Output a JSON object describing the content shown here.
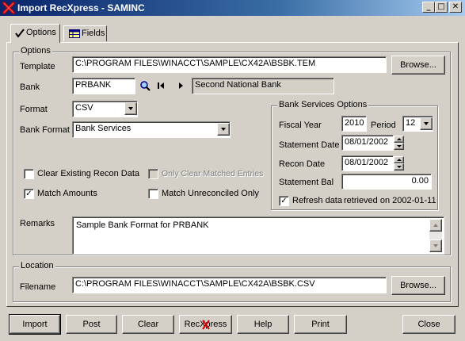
{
  "window": {
    "title": "Import RecXpress - SAMINC",
    "minimize": "_",
    "maximize": "□",
    "close": "✕"
  },
  "tabs": [
    {
      "label": "Options",
      "active": true
    },
    {
      "label": "Fields",
      "active": false
    }
  ],
  "options": {
    "group_label": "Options",
    "template_label": "Template",
    "template_value": "C:\\PROGRAM FILES\\WINACCT\\SAMPLE\\CX42A\\BSBK.TEM",
    "browse_label": "Browse...",
    "bank_label": "Bank",
    "bank_value": "PRBANK",
    "bank_name": "Second National Bank",
    "format_label": "Format",
    "format_value": "CSV",
    "bank_format_label": "Bank Format",
    "bank_format_value": "Bank Services",
    "clear_existing_label": "Clear Existing Recon Data",
    "clear_existing_checked": false,
    "only_clear_matched_label": "Only Clear Matched Entries",
    "only_clear_matched_checked": false,
    "match_amounts_label": "Match Amounts",
    "match_amounts_checked": true,
    "match_unreconciled_label": "Match Unreconciled Only",
    "match_unreconciled_checked": false,
    "remarks_label": "Remarks",
    "remarks_value": "Sample Bank Format for PRBANK"
  },
  "bank_services": {
    "group_label": "Bank Services Options",
    "fiscal_year_label": "Fiscal Year",
    "fiscal_year_value": "2010",
    "period_label": "Period",
    "period_value": "12",
    "statement_date_label": "Statement Date",
    "statement_date_value": "08/01/2002",
    "recon_date_label": "Recon Date",
    "recon_date_value": "08/01/2002",
    "statement_bal_label": "Statement Bal",
    "statement_bal_value": "0.00",
    "refresh_label": "Refresh data",
    "refresh_checked": true,
    "retrieved_text": "retrieved on 2002-01-11"
  },
  "location": {
    "group_label": "Location",
    "filename_label": "Filename",
    "filename_value": "C:\\PROGRAM FILES\\WINACCT\\SAMPLE\\CX42A\\BSBK.CSV",
    "browse_label": "Browse..."
  },
  "buttons": {
    "import": "Import",
    "post": "Post",
    "clear": "Clear",
    "recxpress": "RecXpress",
    "help": "Help",
    "print": "Print",
    "close": "Close"
  },
  "icons": {
    "app": "red-x-icon",
    "lookup": "magnifier-icon",
    "first": "first-record-icon",
    "next": "next-record-icon",
    "fields_tab": "grid-icon",
    "options_tab": "checkmark-icon"
  },
  "colors": {
    "titlebar_start": "#0a246a",
    "titlebar_end": "#a6caf0",
    "face": "#d4d0c8",
    "app_icon_red": "#d40000"
  }
}
